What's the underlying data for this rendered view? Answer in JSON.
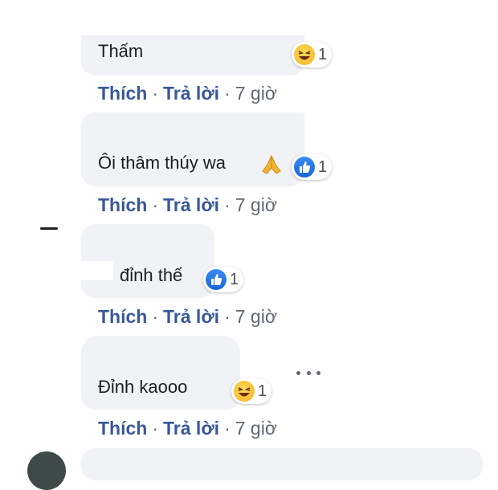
{
  "comments": [
    {
      "text": "Thấm",
      "reaction_type": "haha-icon",
      "reaction_count": "1"
    },
    {
      "text": "Ôi thâm thúy wa",
      "reaction_type": "like-icon",
      "reaction_count": "1"
    },
    {
      "text": "đỉnh thế",
      "reaction_type": "like-icon",
      "reaction_count": "1"
    },
    {
      "text": "Đỉnh kaooo",
      "reaction_type": "haha-icon",
      "reaction_count": "1"
    }
  ],
  "actions": {
    "like_label": "Thích",
    "reply_label": "Trả lời",
    "separator": "·",
    "time": "7 giờ"
  },
  "colors": {
    "link": "#385898",
    "bubble": "#f0f2f5",
    "meta": "#606770"
  }
}
